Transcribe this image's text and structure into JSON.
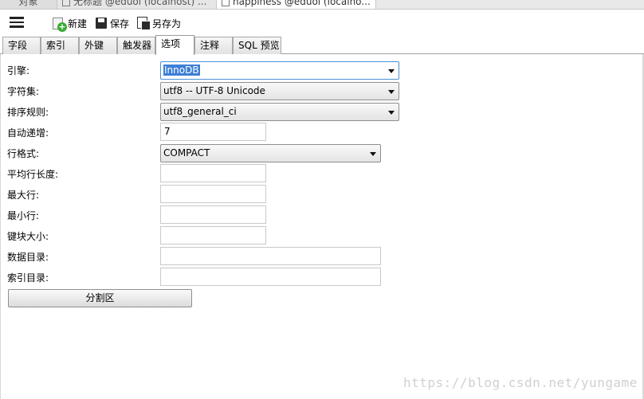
{
  "doc_tabs": [
    {
      "label": "对象"
    },
    {
      "label": "无标题 @eduol (localhost) ..."
    },
    {
      "label": "happiness @eduol (localho..."
    }
  ],
  "toolbar": {
    "menu_icon": "hamburger-icon",
    "new_label": "新建",
    "save_label": "保存",
    "saveas_label": "另存为"
  },
  "sub_tabs": [
    {
      "label": "字段",
      "active": false
    },
    {
      "label": "索引",
      "active": false
    },
    {
      "label": "外键",
      "active": false
    },
    {
      "label": "触发器",
      "active": false
    },
    {
      "label": "选项",
      "active": true
    },
    {
      "label": "注释",
      "active": false
    },
    {
      "label": "SQL 预览",
      "active": false
    }
  ],
  "form": {
    "engine": {
      "label": "引擎:",
      "value": "InnoDB"
    },
    "charset": {
      "label": "字符集:",
      "value": "utf8 -- UTF-8 Unicode"
    },
    "collation": {
      "label": "排序规则:",
      "value": "utf8_general_ci"
    },
    "auto_increment": {
      "label": "自动递增:",
      "value": "7"
    },
    "row_format": {
      "label": "行格式:",
      "value": "COMPACT"
    },
    "avg_row_length": {
      "label": "平均行长度:",
      "value": ""
    },
    "max_rows": {
      "label": "最大行:",
      "value": ""
    },
    "min_rows": {
      "label": "最小行:",
      "value": ""
    },
    "key_block_size": {
      "label": "键块大小:",
      "value": ""
    },
    "data_directory": {
      "label": "数据目录:",
      "value": ""
    },
    "index_directory": {
      "label": "索引目录:",
      "value": ""
    }
  },
  "partition_button": "分割区",
  "watermark": "https://blog.csdn.net/yungame",
  "colors": {
    "accent": "#3d7fd6",
    "new_icon": "#3aa935"
  }
}
